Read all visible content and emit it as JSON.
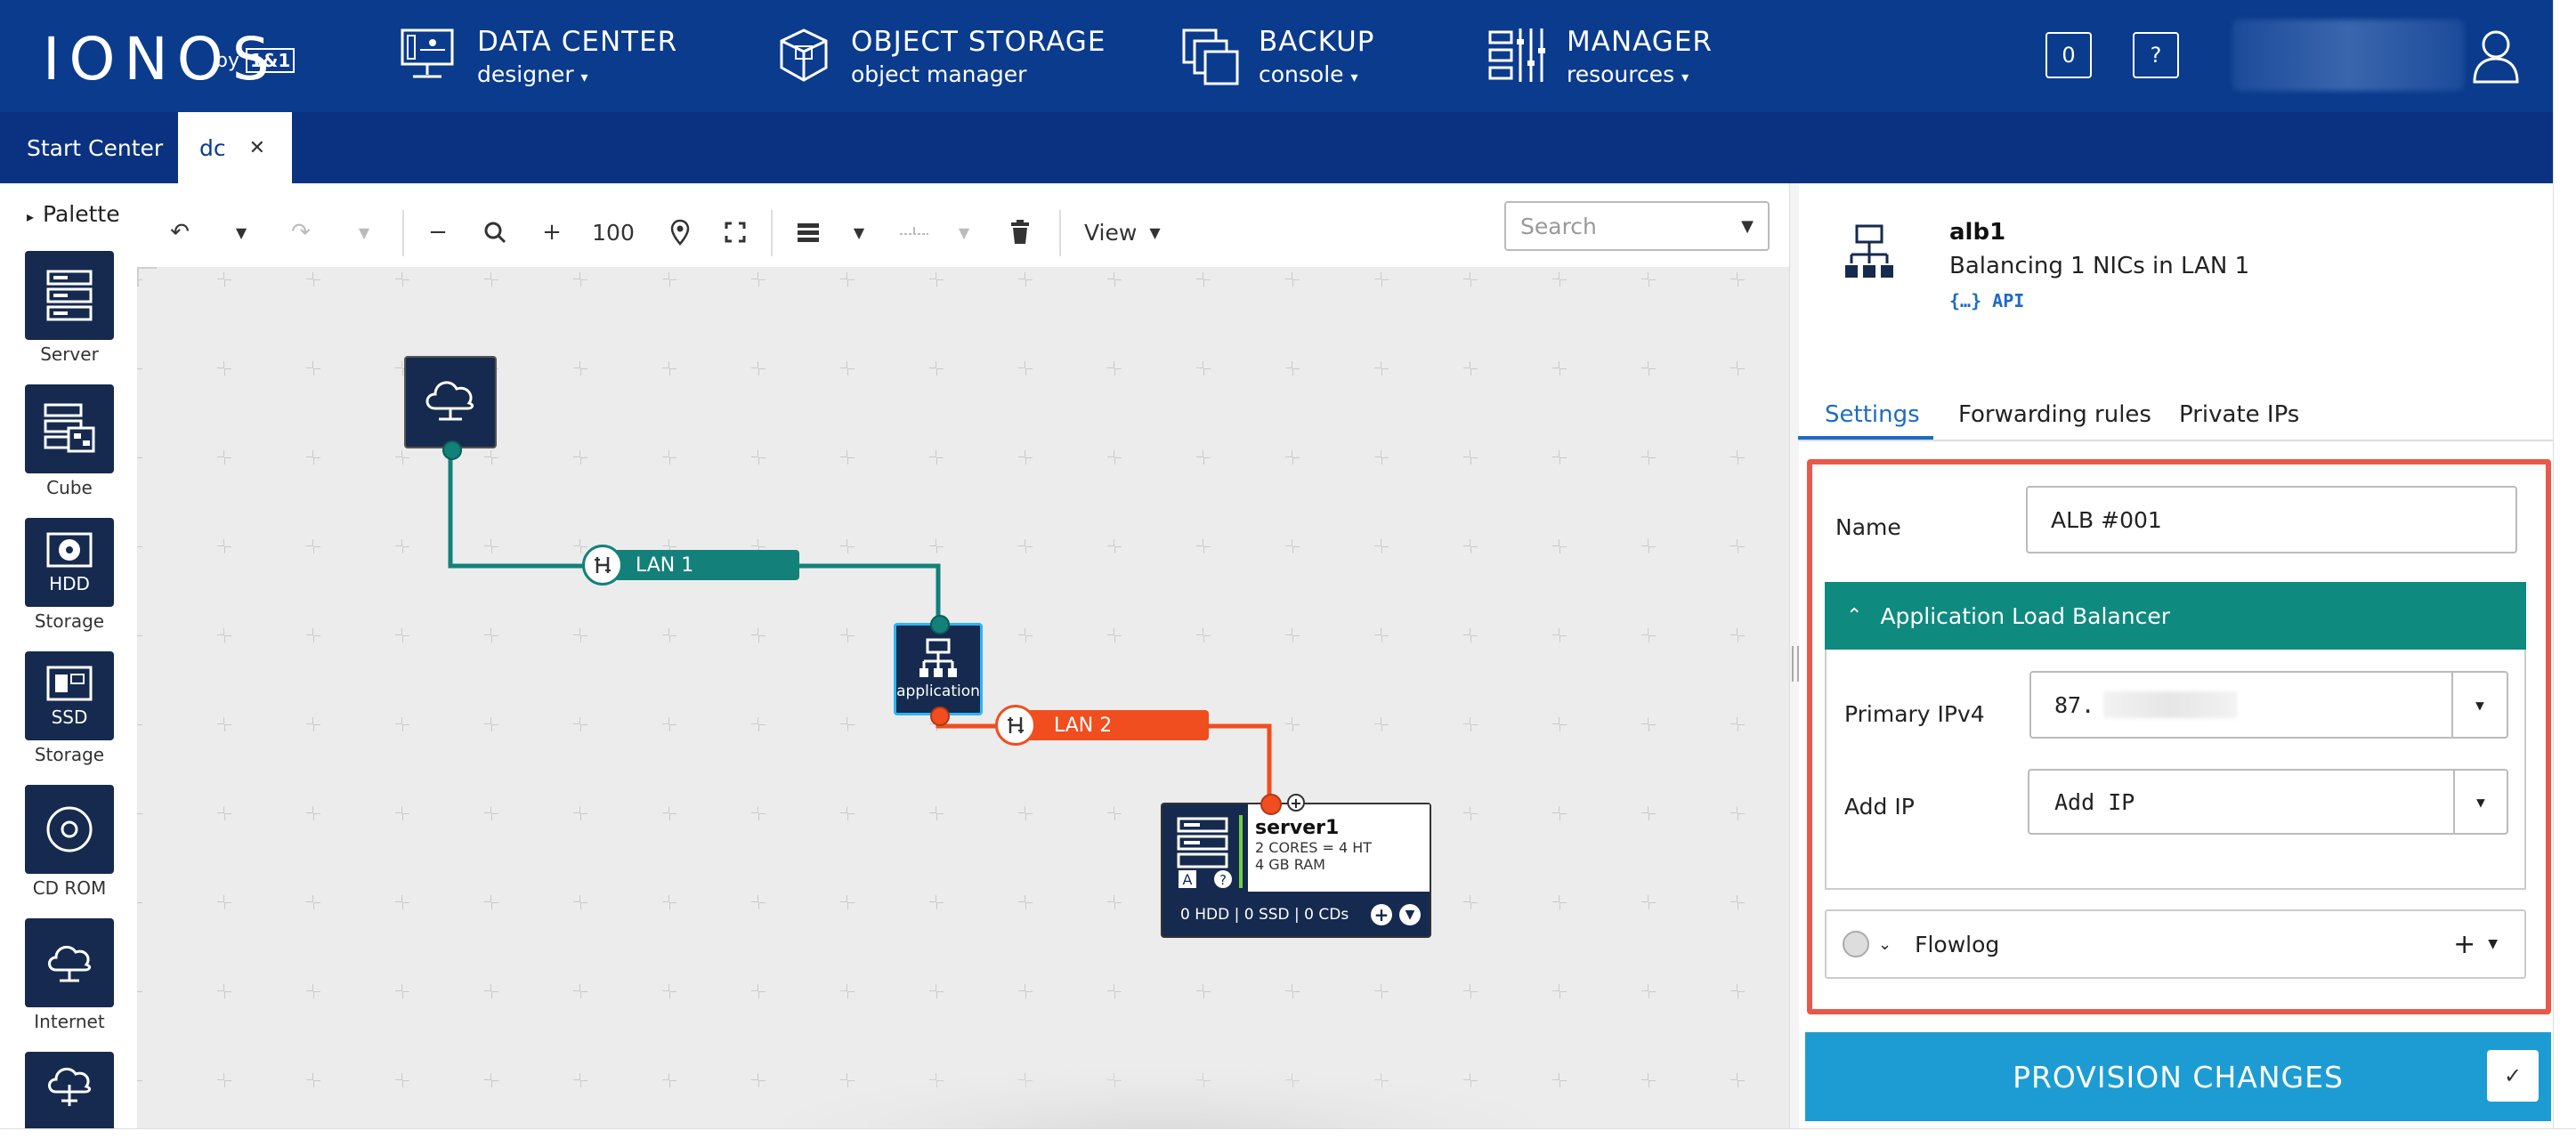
{
  "header": {
    "logo": "IONOS",
    "byline": "by",
    "byline_badge": "1&1",
    "nav": [
      {
        "title": "DATA CENTER",
        "sub": "designer",
        "icon": "data-center-designer-icon"
      },
      {
        "title": "OBJECT STORAGE",
        "sub": "object manager",
        "icon": "object-storage-icon"
      },
      {
        "title": "BACKUP",
        "sub": "console",
        "icon": "backup-icon"
      },
      {
        "title": "MANAGER",
        "sub": "resources",
        "icon": "manager-icon"
      }
    ],
    "counter_button": "0",
    "help_button": "?"
  },
  "tabs": [
    {
      "label": "Start Center",
      "active": false
    },
    {
      "label": "dc",
      "active": true,
      "close": "✕"
    }
  ],
  "palette": {
    "label": "Palette",
    "items": [
      {
        "label": "Server",
        "icon": "server-icon"
      },
      {
        "label": "Cube",
        "icon": "cube-icon"
      },
      {
        "label": "HDD Storage",
        "icon": "hdd-storage-icon"
      },
      {
        "label": "SSD Storage",
        "icon": "ssd-storage-icon"
      },
      {
        "label": "CD ROM",
        "icon": "cd-rom-icon"
      },
      {
        "label": "Internet",
        "icon": "internet-icon"
      }
    ]
  },
  "toolbar": {
    "zoom": "100",
    "view_label": "View",
    "search_placeholder": "Search"
  },
  "canvas": {
    "lan1_label": "LAN 1",
    "lan2_label": "LAN 2",
    "alb_label": "application",
    "server": {
      "name": "server1",
      "specs1": "2 CORES = 4 HT",
      "specs2": "4 GB RAM",
      "footer": "0 HDD | 0 SSD | 0 CDs"
    }
  },
  "colors": {
    "brand": "#0b3b8c",
    "lan1": "#13817a",
    "lan2": "#f04e1f",
    "provision": "#1d9cd3",
    "highlight": "#e8594a"
  },
  "panel": {
    "title": "alb1",
    "subtitle": "Balancing 1 NICs in LAN 1",
    "api_label": "{…} API",
    "tabs": [
      "Settings",
      "Forwarding rules",
      "Private IPs"
    ],
    "name_label": "Name",
    "name_value": "ALB #001",
    "accordion_title": "Application Load Balancer",
    "primary_ipv4_label": "Primary IPv4",
    "primary_ipv4_value": "87.",
    "add_ip_label": "Add IP",
    "add_ip_value": "Add IP",
    "flowlog_label": "Flowlog",
    "provision_button": "PROVISION CHANGES"
  }
}
